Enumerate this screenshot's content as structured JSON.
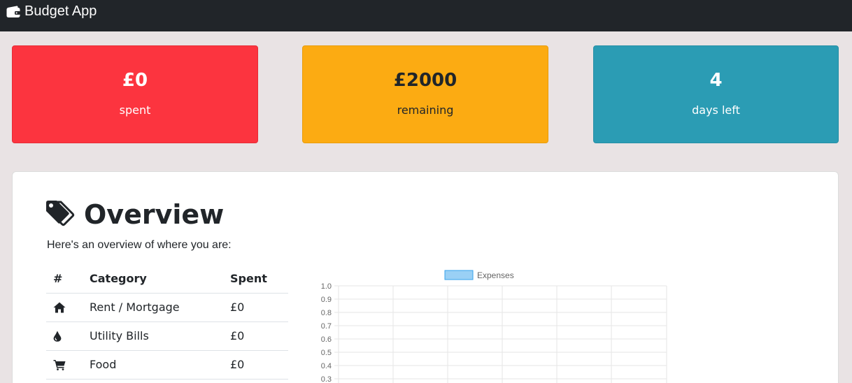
{
  "navbar": {
    "brand": "Budget App",
    "icon": "wallet-icon",
    "background": "#212529"
  },
  "cards": {
    "spent": {
      "value": "£0",
      "label": "spent",
      "color": "#fc343f"
    },
    "remaining": {
      "value": "£2000",
      "label": "remaining",
      "color": "#fcab12"
    },
    "days": {
      "value": "4",
      "label": "days left",
      "color": "#2b9cb4"
    }
  },
  "overview": {
    "title": "Overview",
    "icon": "tags-icon",
    "subtitle": "Here's an overview of where you are:",
    "table": {
      "headers": [
        "#",
        "Category",
        "Spent"
      ],
      "rows": [
        {
          "icon": "home-icon",
          "category": "Rent / Mortgage",
          "spent": "£0"
        },
        {
          "icon": "tint-icon",
          "category": "Utility Bills",
          "spent": "£0"
        },
        {
          "icon": "shopping-cart-icon",
          "category": "Food",
          "spent": "£0"
        }
      ]
    }
  },
  "chart_data": {
    "type": "bar",
    "title": "",
    "xlabel": "",
    "ylabel": "",
    "categories": [],
    "series": [
      {
        "name": "Expenses",
        "values": [],
        "color": "#9ad0f5"
      }
    ],
    "ylim": [
      0.3,
      1.0
    ],
    "yticks": [
      "1.0",
      "0.9",
      "0.8",
      "0.7",
      "0.6",
      "0.5",
      "0.4",
      "0.3"
    ],
    "grid": true,
    "legend_position": "top"
  }
}
